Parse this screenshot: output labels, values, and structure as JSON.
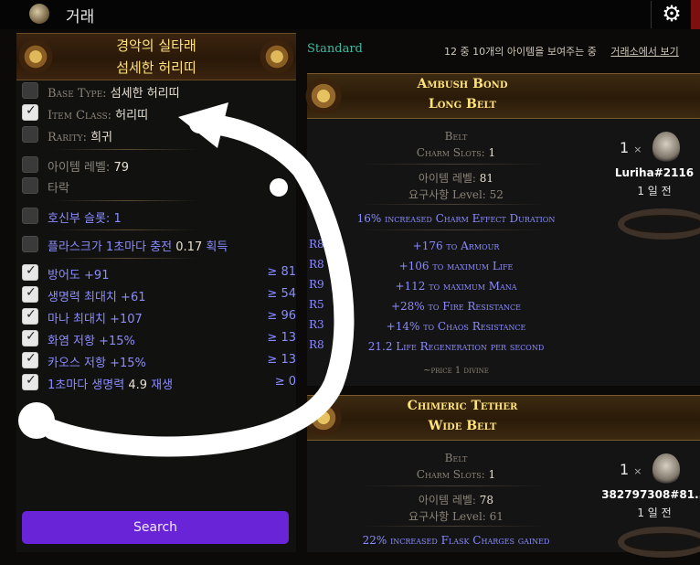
{
  "app": {
    "title": "거래",
    "settings_icon": "gear-icon"
  },
  "filter": {
    "header_line1": "경악의 실타래",
    "header_line2": "섬세한 허리띠",
    "rows": [
      {
        "checked": false,
        "label": "Base Type:",
        "value": "섬세한 허리띠"
      },
      {
        "checked": true,
        "label": "Item Class:",
        "value": "허리띠"
      },
      {
        "checked": false,
        "label": "Rarity:",
        "value": "희귀"
      },
      {
        "checked": false,
        "label": "아이템 레벨:",
        "value": "79"
      },
      {
        "checked": false,
        "label": "타락",
        "value": ""
      },
      {
        "checked": false,
        "label": "호신부 슬롯:",
        "value": "1"
      },
      {
        "checked": false,
        "label": "플라스크가 1초마다 충전",
        "value": "0.17",
        "suffix": "획득"
      },
      {
        "checked": true,
        "label": "방어도",
        "value": "+91",
        "min": "≥ 81"
      },
      {
        "checked": true,
        "label": "생명력 최대치",
        "value": "+61",
        "min": "≥ 54"
      },
      {
        "checked": true,
        "label": "마나 최대치",
        "value": "+107",
        "min": "≥ 96"
      },
      {
        "checked": true,
        "label": "화염 저항",
        "value": "+15%",
        "min": "≥ 13"
      },
      {
        "checked": true,
        "label": "카오스 저항",
        "value": "+15%",
        "min": "≥ 13"
      },
      {
        "checked": true,
        "label": "1초마다 생명력",
        "value": "4.9",
        "suffix": "재생",
        "min": "≥ 0"
      }
    ],
    "search_label": "Search"
  },
  "results": {
    "league": "Standard",
    "count_text": "12 중 10개의 아이템을 보여주는 중",
    "view_link": "거래소에서 보기",
    "items": [
      {
        "name": "Ambush Bond",
        "base": "Long Belt",
        "item_class": "Belt",
        "charm_label": "Charm Slots:",
        "charm_value": "1",
        "ilvl_label": "아이템 레벨:",
        "ilvl_value": "81",
        "req_label": "요구사항 Level:",
        "req_value": "52",
        "implicit": "16% increased Charm Effect Duration",
        "mods": [
          {
            "tag": "R8",
            "text": "+176 to Armour"
          },
          {
            "tag": "R8",
            "text": "+106 to maximum Life"
          },
          {
            "tag": "R9",
            "text": "+112 to maximum Mana"
          },
          {
            "tag": "R5",
            "text": "+28% to Fire Resistance"
          },
          {
            "tag": "R3",
            "text": "+14% to Chaos Resistance"
          },
          {
            "tag": "R8",
            "text": "21.2 Life Regeneration per second"
          }
        ],
        "price": "~price 1 divine",
        "quantity": "1",
        "seller": "Luriha#2116",
        "listed": "1 일 전"
      },
      {
        "name": "Chimeric Tether",
        "base": "Wide Belt",
        "item_class": "Belt",
        "charm_label": "Charm Slots:",
        "charm_value": "1",
        "ilvl_label": "아이템 레벨:",
        "ilvl_value": "78",
        "req_label": "요구사항 Level:",
        "req_value": "61",
        "implicit": "22% increased Flask Charges gained",
        "quantity": "1",
        "seller": "382797308#81...",
        "listed": "1 일 전"
      }
    ]
  },
  "colors": {
    "accent_purple": "#6a24d8",
    "header_gold": "#ffe27a",
    "mod_blue": "#8b8bff",
    "league_teal": "#3fb9a0",
    "annotation": "#ffffff"
  }
}
